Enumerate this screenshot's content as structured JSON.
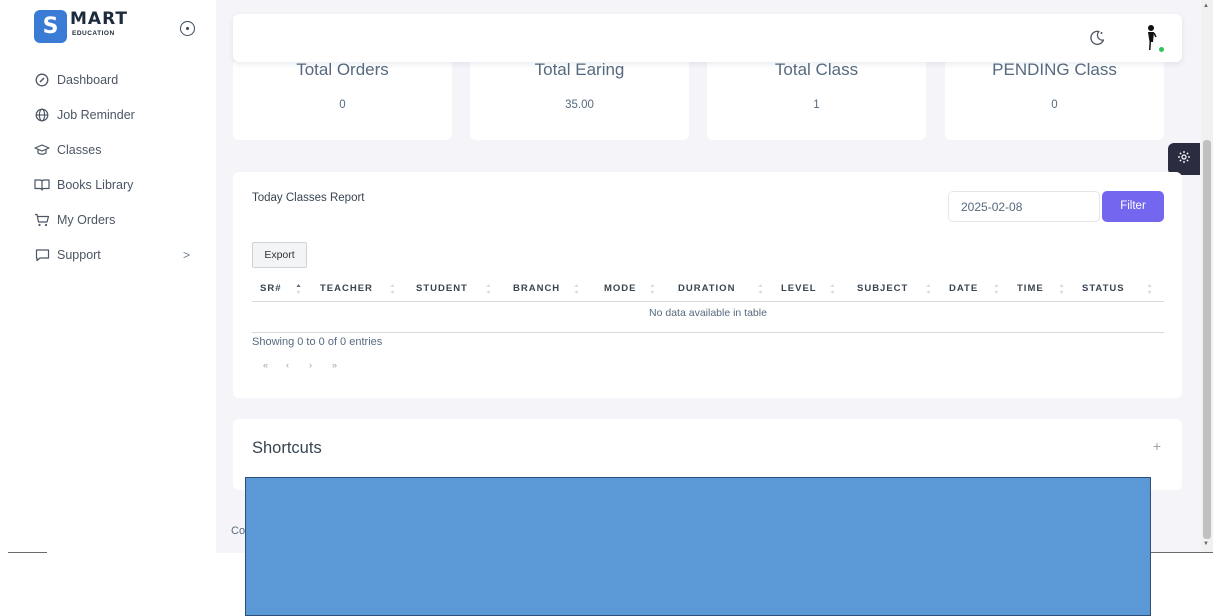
{
  "logo": {
    "letter": "S",
    "word": "MART",
    "sub": "EDUCATION"
  },
  "sidebar": {
    "items": [
      {
        "label": "Dashboard",
        "icon": "dashboard-icon"
      },
      {
        "label": "Job Reminder",
        "icon": "globe-icon"
      },
      {
        "label": "Classes",
        "icon": "graduation-cap-icon"
      },
      {
        "label": "Books Library",
        "icon": "book-open-icon"
      },
      {
        "label": "My Orders",
        "icon": "cart-icon"
      },
      {
        "label": "Support",
        "icon": "message-icon",
        "chevron": ">"
      }
    ]
  },
  "stats": [
    {
      "title": "Total Orders",
      "value": "0"
    },
    {
      "title": "Total Earing",
      "value": "35.00"
    },
    {
      "title": "Total Class",
      "value": "1"
    },
    {
      "title": "PENDING Class",
      "value": "0"
    }
  ],
  "report": {
    "title": "Today Classes Report",
    "date_value": "2025-02-08",
    "filter_label": "Filter",
    "export_label": "Export",
    "columns": [
      "SR#",
      "TEACHER",
      "STUDENT",
      "BRANCH",
      "MODE",
      "DURATION",
      "LEVEL",
      "SUBJECT",
      "DATE",
      "TIME",
      "STATUS"
    ],
    "empty_message": "No data available in table",
    "info": "Showing 0 to 0 of 0 entries",
    "pager": [
      "«",
      "‹",
      "›",
      "»"
    ]
  },
  "shortcuts": {
    "title": "Shortcuts",
    "add": "+"
  },
  "footer": {
    "text": "Co"
  },
  "colors": {
    "primary": "#7367f0",
    "redaction": "#5a98d6",
    "online": "#31c35a",
    "settings_tab": "#2b2c40"
  }
}
